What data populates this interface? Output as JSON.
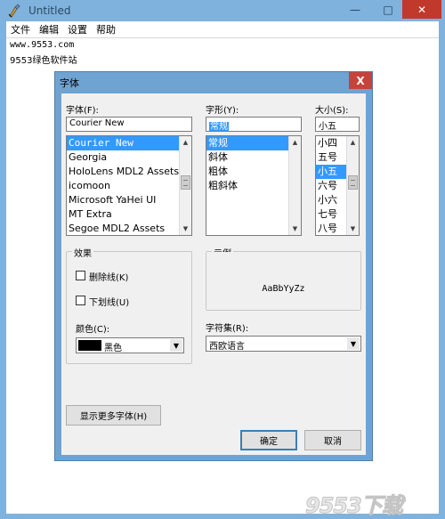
{
  "window": {
    "title": "Untitled",
    "controls": {
      "minimize": "—",
      "maximize": "□",
      "close": "✕"
    }
  },
  "menubar": [
    "文件",
    "编辑",
    "设置",
    "帮助"
  ],
  "document": {
    "lines": [
      "www.9553.com",
      "9553绿色软件站"
    ]
  },
  "dialog": {
    "title": "字体",
    "close": "X",
    "font": {
      "label": "字体(F):",
      "value": "Courier New",
      "items": [
        "Courier New",
        "Georgia",
        "HoloLens MDL2 Assets",
        "icomoon",
        "Microsoft YaHei UI",
        "MT Extra",
        "Segoe MDL2 Assets"
      ],
      "selected": "Courier New"
    },
    "style": {
      "label": "字形(Y):",
      "value": "常规",
      "items": [
        "常规",
        "斜体",
        "粗体",
        "粗斜体"
      ],
      "selected": "常规"
    },
    "size": {
      "label": "大小(S):",
      "value": "小五",
      "items": [
        "小四",
        "五号",
        "小五",
        "六号",
        "小六",
        "七号",
        "八号"
      ],
      "selected": "小五"
    },
    "effects": {
      "title": "效果",
      "strikeout": "删除线(K)",
      "underline": "下划线(U)",
      "color_label": "颜色(C):",
      "color_value": "黑色",
      "color_swatch": "#000000"
    },
    "sample": {
      "title": "示例",
      "text": "AaBbYyZz"
    },
    "charset": {
      "label": "字符集(R):",
      "value": "西欧语言"
    },
    "more_fonts": "显示更多字体(H)",
    "ok": "确定",
    "cancel": "取消"
  },
  "watermark": "9553下载",
  "colors": {
    "frame": "#7fb2dc",
    "dialog_frame": "#6fa3d2",
    "close_red": "#c0392b",
    "selection": "#3399ff",
    "dialog_body": "#f0f0f0"
  }
}
